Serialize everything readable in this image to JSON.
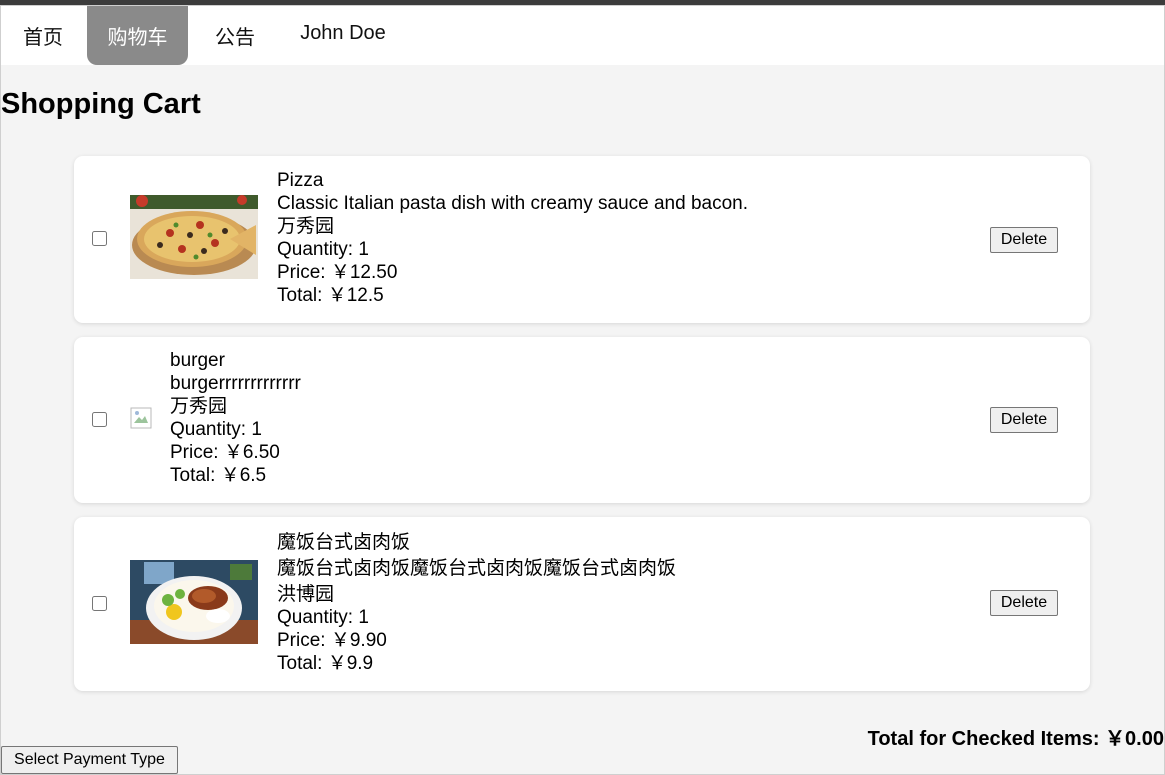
{
  "nav": {
    "home": "首页",
    "cart": "购物车",
    "announcements": "公告",
    "user": "John Doe"
  },
  "page_title": "Shopping Cart",
  "items": [
    {
      "name": "Pizza",
      "description": "Classic Italian pasta dish with creamy sauce and bacon.",
      "shop": "万秀园",
      "quantity": "Quantity: 1",
      "price": "Price: ￥12.50",
      "total": "Total: ￥12.5",
      "checked": false,
      "image": "pizza-photo",
      "delete_label": "Delete"
    },
    {
      "name": "burger",
      "description": "burgerrrrrrrrrrrrr",
      "shop": "万秀园",
      "quantity": "Quantity: 1",
      "price": "Price: ￥6.50",
      "total": "Total: ￥6.5",
      "checked": false,
      "image": "broken-image-icon",
      "delete_label": "Delete"
    },
    {
      "name": "魔饭台式卤肉饭",
      "description": "魔饭台式卤肉饭魔饭台式卤肉饭魔饭台式卤肉饭",
      "shop": "洪博园",
      "quantity": "Quantity: 1",
      "price": "Price: ￥9.90",
      "total": "Total: ￥9.9",
      "checked": false,
      "image": "braised-pork-rice-photo",
      "delete_label": "Delete"
    }
  ],
  "total_checked": "Total for Checked Items: ￥0.00",
  "payment_button": "Select Payment Type",
  "colors": {
    "active_tab": "#8a8a8a",
    "page_background": "#f4f4f4",
    "card_background": "#ffffff"
  }
}
